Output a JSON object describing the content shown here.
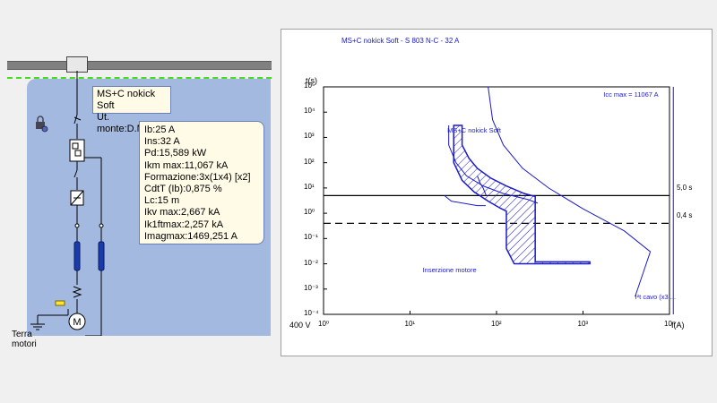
{
  "diagram": {
    "name_box": {
      "line1": "MS+C nokick Soft",
      "line2": "Ut. monte:D.MT.0"
    },
    "data_lines": [
      "Ib:25 A",
      "Ins:32 A",
      "Pd:15,589 kW",
      "Ikm max:11,067 kA",
      "Formazione:3x(1x4) [x2]",
      "CdtT (Ib):0,875 %",
      "Lc:15 m",
      "Ikv max:2,667 kA",
      "Ik1ftmax:2,257 kA",
      "Imagmax:1469,251 A"
    ],
    "terra_label": {
      "line1": "Terra",
      "line2": "motori"
    },
    "colors": {
      "background": "#a3b9df",
      "bus_dashed": "#44dd22",
      "label_box": "#fffbe6",
      "fuse": "#1a3caa"
    }
  },
  "chart_data": {
    "type": "line",
    "title": "MS+C nokick Soft - S 803 N-C - 32 A",
    "ylabel": "t(s)",
    "xlabel": "I(A)",
    "voltage_label": "400 V",
    "xscale": "log",
    "yscale": "log",
    "xlim": [
      1,
      10000
    ],
    "ylim": [
      0.0001,
      100000
    ],
    "xticks": [
      {
        "v": 1,
        "label": "10⁰"
      },
      {
        "v": 10,
        "label": "10¹"
      },
      {
        "v": 100,
        "label": "10²"
      },
      {
        "v": 1000,
        "label": "10³"
      },
      {
        "v": 10000,
        "label": "10⁴"
      }
    ],
    "yticks": [
      {
        "v": 100000,
        "label": "10⁵"
      },
      {
        "v": 10000,
        "label": "10⁴"
      },
      {
        "v": 1000,
        "label": "10³"
      },
      {
        "v": 100,
        "label": "10²"
      },
      {
        "v": 10,
        "label": "10¹"
      },
      {
        "v": 1,
        "label": "10⁰"
      },
      {
        "v": 0.1,
        "label": "10⁻¹"
      },
      {
        "v": 0.01,
        "label": "10⁻²"
      },
      {
        "v": 0.001,
        "label": "10⁻³"
      },
      {
        "v": 0.0001,
        "label": "10⁻⁴"
      }
    ],
    "grid": false,
    "hlines": [
      {
        "y": 5,
        "label": "5,0 s",
        "style": "solid"
      },
      {
        "y": 0.4,
        "label": "0,4 s",
        "style": "dashed"
      }
    ],
    "vline": {
      "x": 11067,
      "label": "Icc max = 11067 A"
    },
    "series": [
      {
        "name": "MS+C nokick Soft",
        "band": true,
        "upper": [
          [
            40,
            3000
          ],
          [
            40,
            500
          ],
          [
            48,
            150
          ],
          [
            60,
            60
          ],
          [
            85,
            25
          ],
          [
            130,
            12
          ],
          [
            210,
            6
          ],
          [
            280,
            4.6
          ],
          [
            280,
            0.012
          ],
          [
            1200,
            0.012
          ]
        ],
        "lower": [
          [
            32,
            3000
          ],
          [
            32,
            100
          ],
          [
            40,
            20
          ],
          [
            55,
            7
          ],
          [
            80,
            3
          ],
          [
            110,
            1.6
          ],
          [
            130,
            1.2
          ],
          [
            130,
            0.04
          ],
          [
            160,
            0.01
          ],
          [
            1200,
            0.01
          ]
        ]
      },
      {
        "name": "",
        "points": [
          [
            28,
            3000
          ],
          [
            28,
            500
          ],
          [
            34,
            100
          ],
          [
            45,
            30
          ],
          [
            70,
            12
          ],
          [
            120,
            6
          ],
          [
            230,
            3.5
          ],
          [
            300,
            2.5
          ]
        ]
      },
      {
        "name": "",
        "points": [
          [
            60,
            30
          ],
          [
            65,
            15
          ],
          [
            70,
            10
          ],
          [
            76,
            5
          ]
        ]
      },
      {
        "name": "",
        "points": [
          [
            80,
            100000
          ],
          [
            90,
            5000
          ],
          [
            120,
            500
          ],
          [
            200,
            60
          ],
          [
            400,
            10
          ],
          [
            1000,
            1.5
          ],
          [
            3000,
            0.2
          ],
          [
            6000,
            0.03
          ],
          [
            4000,
            0.0005
          ]
        ]
      },
      {
        "name": "",
        "points": [
          [
            25,
            5
          ],
          [
            30,
            3
          ],
          [
            60,
            2
          ],
          [
            75,
            2
          ]
        ]
      }
    ],
    "annotations": [
      {
        "x": 27,
        "y": 2000,
        "text": "MS+C nokick Soft"
      },
      {
        "x": 14,
        "y": 0.006,
        "text": "Inserzione motore"
      },
      {
        "x": 4000,
        "y": 0.0005,
        "text": "I²t cavo (x3 ..."
      }
    ],
    "colors": {
      "curve": "#1a1acc",
      "line": "#000000"
    }
  }
}
